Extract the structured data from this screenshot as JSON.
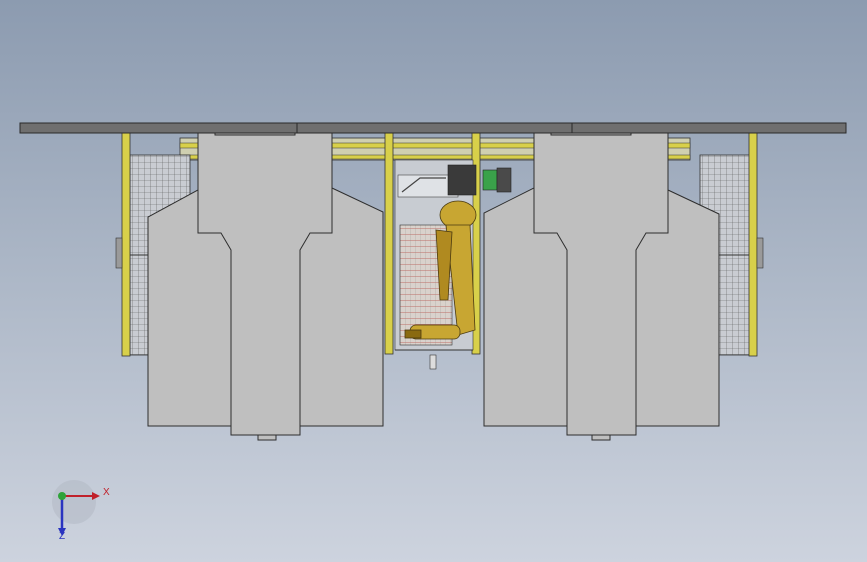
{
  "viewport": {
    "background_top": "#8c9bb0",
    "background_bottom": "#cdd3de"
  },
  "model": {
    "frame_color": "#d8d04a",
    "panel_color": "#bfbfbf",
    "roof_color": "#6f6f6f",
    "mesh_color": "#5a5a5a",
    "robot_color": "#c8a632"
  },
  "triad": {
    "x_label": "X",
    "z_label": "Z",
    "x_color": "#c0202a",
    "y_color": "#2fa33a",
    "z_color": "#2a34c0"
  }
}
